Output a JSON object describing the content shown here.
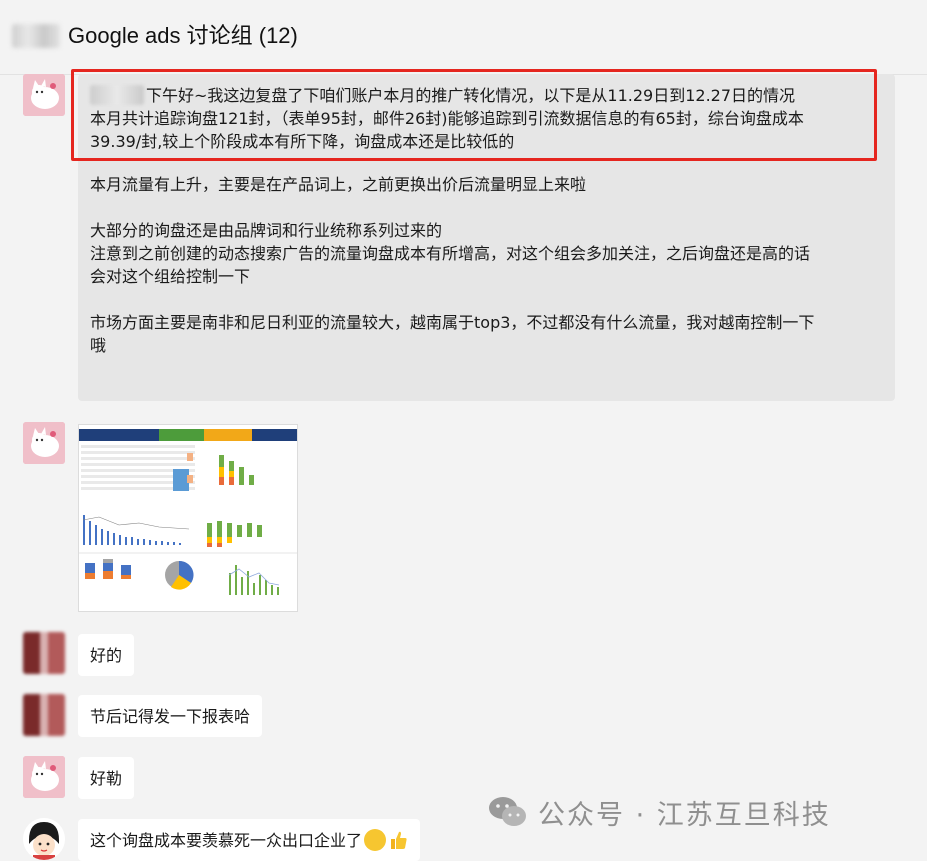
{
  "header": {
    "title": "Google ads 讨论组 (12)"
  },
  "messages": [
    {
      "sender": "cat-avatar",
      "highlighted_lines": [
        "下午好~我这边复盘了下咱们账户本月的推广转化情况，以下是从11.29日到12.27日的情况",
        "本月共计追踪询盘121封，（表单95封，邮件26封)能够追踪到引流数据信息的有65封，综台询盘成本",
        "39.39/封,较上个阶段成本有所下降，询盘成本还是比较低的"
      ],
      "paragraphs": [
        "本月流量有上升，主要是在产品词上，之前更换出价后流量明显上来啦",
        "大部分的询盘还是由品牌词和行业统称系列过来的",
        "注意到之前创建的动态搜索广告的流量询盘成本有所增高，对这个组会多加关注，之后询盘还是高的话",
        "会对这个组给控制一下",
        "市场方面主要是南非和尼日利亚的流量较大，越南属于top3，不过都没有什么流量，我对越南控制一下",
        "哦"
      ]
    },
    {
      "sender": "cat-avatar",
      "image": "report-dashboard-image"
    },
    {
      "sender": "blurred-avatar",
      "text": "好的"
    },
    {
      "sender": "blurred-avatar",
      "text": "节后记得发一下报表哈"
    },
    {
      "sender": "cat-avatar",
      "text": "好勒"
    },
    {
      "sender": "girl-avatar",
      "text": "这个询盘成本要羡慕死一众出口企业了"
    }
  ],
  "watermark": {
    "text": "公众号 · 江苏互旦科技",
    "icon": "wechat-icon"
  },
  "colors": {
    "background": "#f3f3f3",
    "bubble": "#e6e6e6",
    "highlight": "#e5261f",
    "bubble_white": "#ffffff"
  }
}
